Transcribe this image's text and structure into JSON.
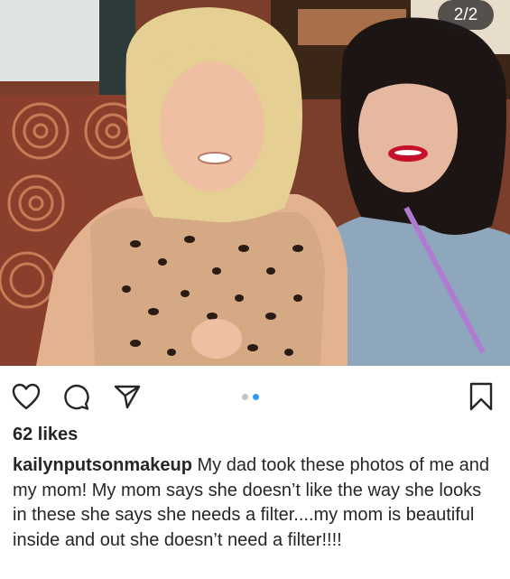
{
  "carousel": {
    "counter": "2/2"
  },
  "actions": {
    "like_icon": "heart-outline-icon",
    "comment_icon": "comment-bubble-icon",
    "share_icon": "paper-plane-icon",
    "save_icon": "bookmark-outline-icon"
  },
  "indicator": {
    "active_color": "#3897f0",
    "inactive_color": "#c4c4c4",
    "active_index": 2,
    "total": 2
  },
  "post": {
    "likes": "62 likes",
    "username": "kailynputsonmakeup",
    "caption": " My dad took these photos of me and my mom! My mom says she doesn’t like the way she looks in these she says she needs a filter....my mom is beautiful inside and out she doesn’t need a filter!!!!"
  }
}
